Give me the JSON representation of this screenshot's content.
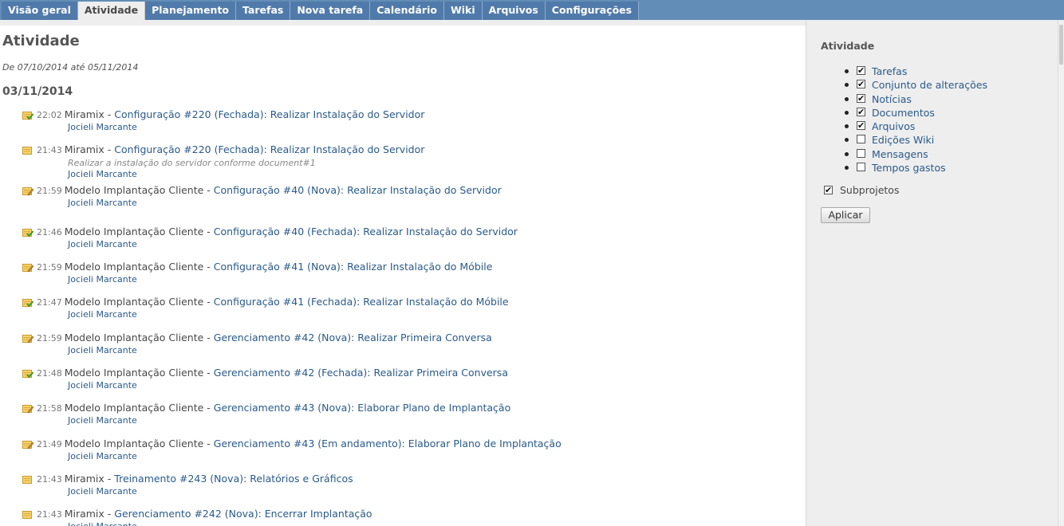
{
  "tabs": [
    {
      "label": "Visão geral",
      "selected": false
    },
    {
      "label": "Atividade",
      "selected": true
    },
    {
      "label": "Planejamento",
      "selected": false
    },
    {
      "label": "Tarefas",
      "selected": false
    },
    {
      "label": "Nova tarefa",
      "selected": false
    },
    {
      "label": "Calendário",
      "selected": false
    },
    {
      "label": "Wiki",
      "selected": false
    },
    {
      "label": "Arquivos",
      "selected": false
    },
    {
      "label": "Configurações",
      "selected": false
    }
  ],
  "page": {
    "title": "Atividade",
    "date_range": "De 07/10/2014 até 05/11/2014",
    "day_heading": "03/11/2014"
  },
  "events": [
    {
      "icon": "issue-closed-icon",
      "time": "22:02",
      "project": "Miramix",
      "link": "Configuração #220 (Fechada): Realizar Instalação do Servidor",
      "description": "",
      "author": "Jocieli Marcante"
    },
    {
      "icon": "issue-icon",
      "time": "21:43",
      "project": "Miramix",
      "link": "Configuração #220 (Fechada): Realizar Instalação do Servidor",
      "description": "Realizar a instalação do servidor conforme document#1",
      "author": "Jocieli Marcante"
    },
    {
      "icon": "issue-edit-icon",
      "time": "21:59",
      "project": "Modelo Implantação Cliente",
      "link": "Configuração #40 (Nova): Realizar Instalação do Servidor",
      "description": "",
      "author": "Jocieli Marcante"
    },
    {
      "icon": "issue-closed-icon",
      "time": "21:46",
      "project": "Modelo Implantação Cliente",
      "link": "Configuração #40 (Fechada): Realizar Instalação do Servidor",
      "description": "",
      "author": "Jocieli Marcante"
    },
    {
      "icon": "issue-edit-icon",
      "time": "21:59",
      "project": "Modelo Implantação Cliente",
      "link": "Configuração #41 (Nova): Realizar Instalação do Móbile",
      "description": "",
      "author": "Jocieli Marcante"
    },
    {
      "icon": "issue-closed-icon",
      "time": "21:47",
      "project": "Modelo Implantação Cliente",
      "link": "Configuração #41 (Fechada): Realizar Instalação do Móbile",
      "description": "",
      "author": "Jocieli Marcante"
    },
    {
      "icon": "issue-edit-icon",
      "time": "21:59",
      "project": "Modelo Implantação Cliente",
      "link": "Gerenciamento #42 (Nova): Realizar Primeira Conversa",
      "description": "",
      "author": "Jocieli Marcante"
    },
    {
      "icon": "issue-closed-icon",
      "time": "21:48",
      "project": "Modelo Implantação Cliente",
      "link": "Gerenciamento #42 (Fechada): Realizar Primeira Conversa",
      "description": "",
      "author": "Jocieli Marcante"
    },
    {
      "icon": "issue-edit-icon",
      "time": "21:58",
      "project": "Modelo Implantação Cliente",
      "link": "Gerenciamento #43 (Nova): Elaborar Plano de Implantação",
      "description": "",
      "author": "Jocieli Marcante"
    },
    {
      "icon": "issue-edit-icon",
      "time": "21:49",
      "project": "Modelo Implantação Cliente",
      "link": "Gerenciamento #43 (Em andamento): Elaborar Plano de Implantação",
      "description": "",
      "author": "Jocieli Marcante"
    },
    {
      "icon": "issue-icon",
      "time": "21:43",
      "project": "Miramix",
      "link": "Treinamento #243 (Nova): Relatórios e Gráficos",
      "description": "",
      "author": "Jocieli Marcante"
    },
    {
      "icon": "issue-icon",
      "time": "21:43",
      "project": "Miramix",
      "link": "Gerenciamento #242 (Nova): Encerrar Implantação",
      "description": "",
      "author": "Jocieli Marcante"
    }
  ],
  "sidebar": {
    "title": "Atividade",
    "filters": [
      {
        "label": "Tarefas",
        "checked": true
      },
      {
        "label": "Conjunto de alterações",
        "checked": true
      },
      {
        "label": "Notícias",
        "checked": true
      },
      {
        "label": "Documentos",
        "checked": true
      },
      {
        "label": "Arquivos",
        "checked": true
      },
      {
        "label": "Edições Wiki",
        "checked": false
      },
      {
        "label": "Mensagens",
        "checked": false
      },
      {
        "label": "Tempos gastos",
        "checked": false
      }
    ],
    "subprojects": {
      "label": "Subprojetos",
      "checked": true
    },
    "apply_label": "Aplicar"
  },
  "separator": " - "
}
